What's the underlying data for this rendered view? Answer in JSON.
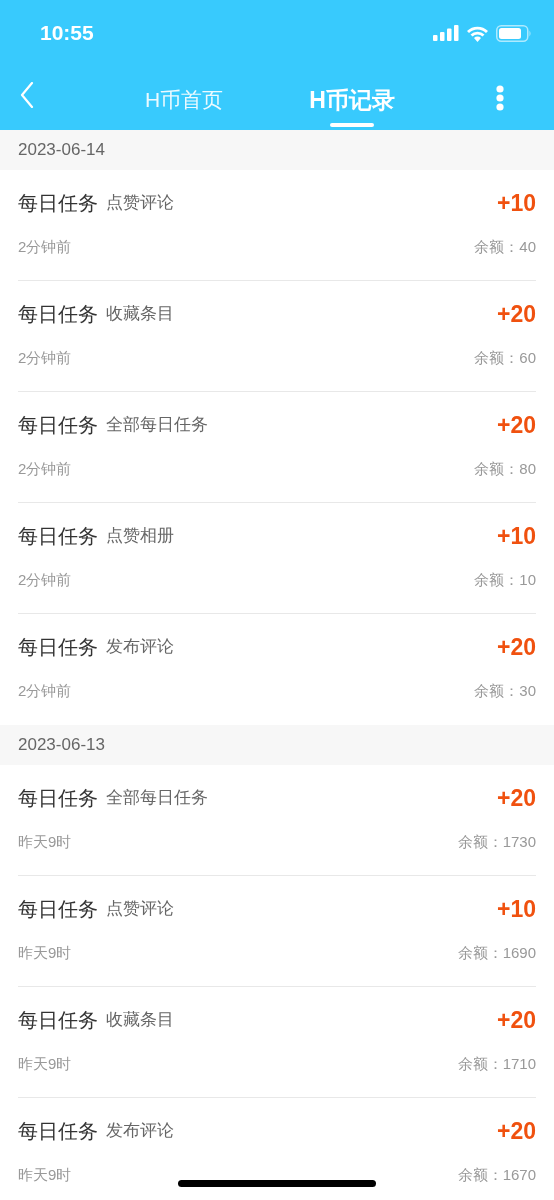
{
  "status_bar": {
    "time": "10:55"
  },
  "tabs": [
    {
      "label": "H币首页",
      "selected": false
    },
    {
      "label": "H币记录",
      "selected": true
    }
  ],
  "groups": [
    {
      "date": "2023-06-14",
      "records": [
        {
          "category": "每日任务",
          "task": "点赞评论",
          "amount": "+10",
          "time": "2分钟前",
          "balance": "余额：40"
        },
        {
          "category": "每日任务",
          "task": "收藏条目",
          "amount": "+20",
          "time": "2分钟前",
          "balance": "余额：60"
        },
        {
          "category": "每日任务",
          "task": "全部每日任务",
          "amount": "+20",
          "time": "2分钟前",
          "balance": "余额：80"
        },
        {
          "category": "每日任务",
          "task": "点赞相册",
          "amount": "+10",
          "time": "2分钟前",
          "balance": "余额：10"
        },
        {
          "category": "每日任务",
          "task": "发布评论",
          "amount": "+20",
          "time": "2分钟前",
          "balance": "余额：30"
        }
      ]
    },
    {
      "date": "2023-06-13",
      "records": [
        {
          "category": "每日任务",
          "task": "全部每日任务",
          "amount": "+20",
          "time": "昨天9时",
          "balance": "余额：1730"
        },
        {
          "category": "每日任务",
          "task": "点赞评论",
          "amount": "+10",
          "time": "昨天9时",
          "balance": "余额：1690"
        },
        {
          "category": "每日任务",
          "task": "收藏条目",
          "amount": "+20",
          "time": "昨天9时",
          "balance": "余额：1710"
        },
        {
          "category": "每日任务",
          "task": "发布评论",
          "amount": "+20",
          "time": "昨天9时",
          "balance": "余额：1670"
        }
      ]
    }
  ]
}
